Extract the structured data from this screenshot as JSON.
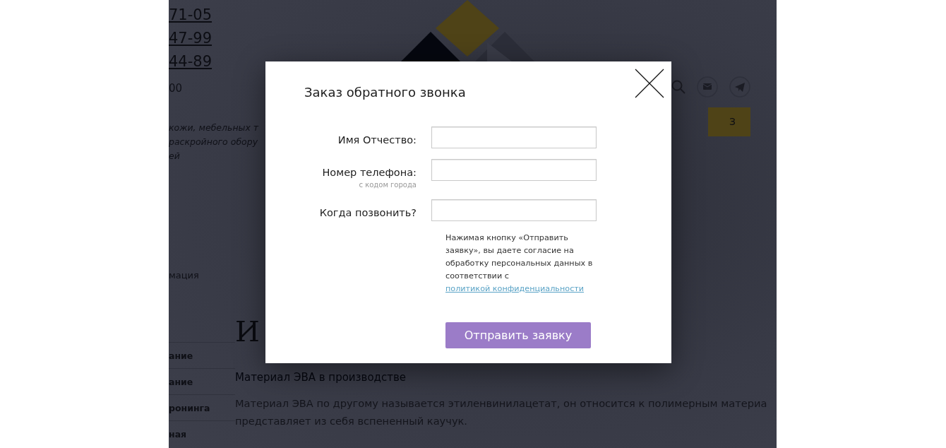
{
  "header": {
    "phones": [
      "71-05",
      "47-99",
      "44-89"
    ],
    "hours": "00",
    "tagline": [
      "кожи, мебельных т",
      "раскройного обору",
      "ей"
    ],
    "action_button": "З"
  },
  "sidebar": {
    "heading": "мация",
    "items": [
      "ание",
      "ание",
      "ронинга",
      "ная"
    ]
  },
  "article": {
    "heading": "И",
    "link": "Материал ЭВА в производстве",
    "paragraph": [
      "Материал ЭВА по другому называется этиленвинилацетат, он относится к полимерным материа",
      "представляет из себя вспененный каучук."
    ]
  },
  "modal": {
    "title": "Заказ обратного звонка",
    "fields": [
      {
        "label": "Имя Отчество:"
      },
      {
        "label": "Номер телефона:",
        "hint": "с кодом города"
      },
      {
        "label": "Когда позвонить?"
      }
    ],
    "consent": {
      "text": "Нажимая кнопку «Отправить заявку», вы даете согласие на обработку персональных данных в соответствии с ",
      "link": "политикой конфиденциальности"
    },
    "submit": "Отправить заявку"
  }
}
